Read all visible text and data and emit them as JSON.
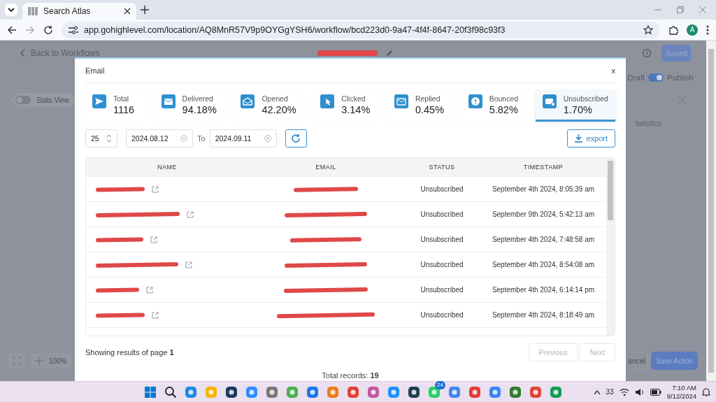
{
  "browser": {
    "tab_title": "Search Atlas",
    "url": "app.gohighlevel.com/location/AQ8MnR57V9p9OYGgYSH6/workflow/bcd223d0-9a47-4f4f-8647-20f3f98c93f3",
    "profile_initial": "A"
  },
  "workflow": {
    "back_link": "Back to Workflows",
    "save_button": {
      "label": "Saved",
      "disabled": true
    },
    "publish_toggle": {
      "off_label": "Draft",
      "on_label": "Publish",
      "on": true
    },
    "stats_view": {
      "label": "Stats View",
      "on": false
    },
    "panel_text": "tatistics",
    "zoom_level": "100%",
    "cancel_button": "ancel",
    "save_action_button": "Save Action"
  },
  "modal": {
    "title": "Email",
    "close": "x",
    "stats": [
      {
        "kind": "sent",
        "label": "Total",
        "value": "1116",
        "selected": false
      },
      {
        "kind": "delivered",
        "label": "Delivered",
        "value": "94.18%",
        "selected": false
      },
      {
        "kind": "opened",
        "label": "Opened",
        "value": "42.20%",
        "selected": false
      },
      {
        "kind": "clicked",
        "label": "Clicked",
        "value": "3.14%",
        "selected": false
      },
      {
        "kind": "replied",
        "label": "Replied",
        "value": "0.45%",
        "selected": false
      },
      {
        "kind": "bounced",
        "label": "Bounced",
        "value": "5.82%",
        "selected": false
      },
      {
        "kind": "unsubscribed",
        "label": "Unsubscribed",
        "value": "1.70%",
        "selected": true
      }
    ],
    "page_size": "25",
    "date_from": "2024.08.12",
    "date_to_label": "To",
    "date_to": "2024.09.11",
    "export_button": "export",
    "table": {
      "columns": [
        "NAME",
        "EMAIL",
        "STATUS",
        "TIMESTAMP"
      ],
      "rows": [
        {
          "status": "Unsubscribed",
          "timestamp": "September 4th 2024, 8:05:39 am"
        },
        {
          "status": "Unsubscribed",
          "timestamp": "September 9th 2024, 5:42:13 am"
        },
        {
          "status": "Unsubscribed",
          "timestamp": "September 4th 2024, 7:48:58 am"
        },
        {
          "status": "Unsubscribed",
          "timestamp": "September 4th 2024, 8:54:08 am"
        },
        {
          "status": "Unsubscribed",
          "timestamp": "September 4th 2024, 6:14:14 pm"
        },
        {
          "status": "Unsubscribed",
          "timestamp": "September 4th 2024, 8:18:49 am"
        }
      ]
    },
    "footer": {
      "page_text": "Showing results of page **1**",
      "previous": {
        "label": "Previous",
        "disabled": true
      },
      "next": {
        "label": "Next",
        "disabled": true
      },
      "total_text": "Total records: **19**"
    }
  },
  "taskbar": {
    "apps": [
      {
        "kind": "windows",
        "color": "#0078d4"
      },
      {
        "kind": "search",
        "color": "#222222"
      },
      {
        "kind": "app",
        "color": "#1e88e5"
      },
      {
        "kind": "app",
        "color": "#f4b400"
      },
      {
        "kind": "app",
        "color": "#1b3a5c"
      },
      {
        "kind": "app",
        "color": "#2d8cff"
      },
      {
        "kind": "app",
        "color": "#777777"
      },
      {
        "kind": "app",
        "color": "#4caf50"
      },
      {
        "kind": "app",
        "color": "#1877f2"
      },
      {
        "kind": "app",
        "color": "#f07b19"
      },
      {
        "kind": "app",
        "color": "#e34133"
      },
      {
        "kind": "app",
        "color": "#c05a9c"
      },
      {
        "kind": "app",
        "color": "#1e90ff"
      },
      {
        "kind": "app",
        "color": "#1f3f4f"
      },
      {
        "kind": "app",
        "color": "#25d366",
        "badge": "24"
      },
      {
        "kind": "app",
        "color": "#4285f4"
      },
      {
        "kind": "app",
        "color": "#e53935"
      },
      {
        "kind": "app",
        "color": "#3b82f6"
      },
      {
        "kind": "app",
        "color": "#2e7d32"
      },
      {
        "kind": "app",
        "color": "#db4437"
      },
      {
        "kind": "app",
        "color": "#0f9d58"
      }
    ],
    "tray_number": "33",
    "time": "7:10 AM",
    "date": "9/12/2024"
  }
}
